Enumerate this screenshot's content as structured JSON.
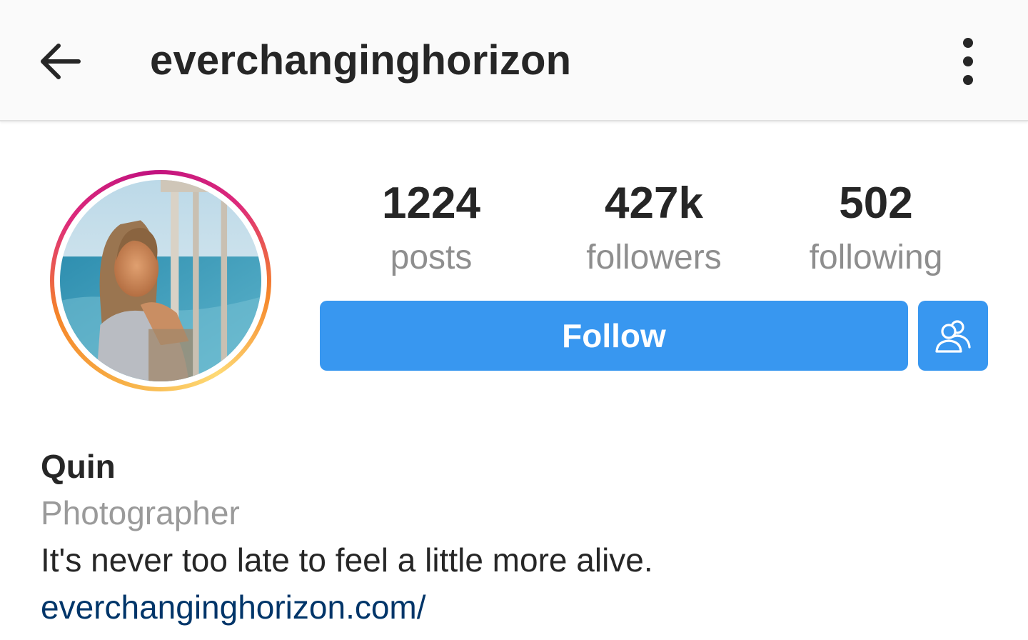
{
  "header": {
    "username": "everchanginghorizon",
    "back_icon": "arrow-left-icon",
    "more_icon": "more-vertical-icon"
  },
  "profile": {
    "avatar_alt": "profile photo",
    "has_story_ring": true,
    "story_ring_colors": [
      "#f58529",
      "#dd2a7b",
      "#c1127f",
      "#feda75"
    ]
  },
  "stats": {
    "posts": {
      "count": "1224",
      "label": "posts"
    },
    "followers": {
      "count": "427k",
      "label": "followers"
    },
    "following": {
      "count": "502",
      "label": "following"
    }
  },
  "actions": {
    "follow_label": "Follow",
    "suggest_icon": "add-people-icon",
    "accent_color": "#3897f0"
  },
  "bio": {
    "name": "Quin",
    "category": "Photographer",
    "text": "It's never too late to feel a little more alive.",
    "link": "everchanginghorizon.com/",
    "link_color": "#003569"
  }
}
